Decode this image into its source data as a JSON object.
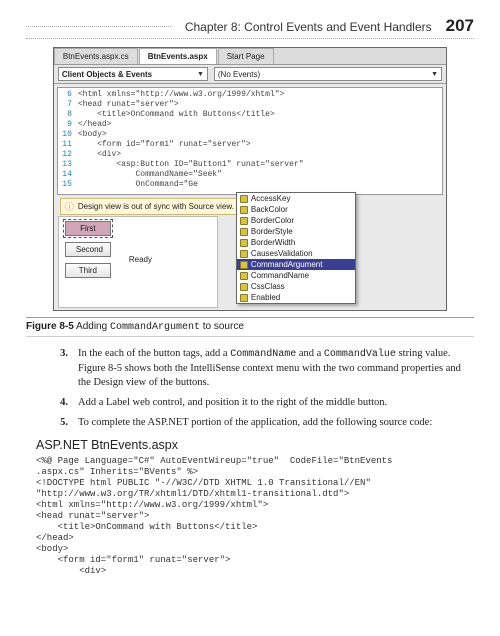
{
  "header": {
    "chapter": "Chapter 8:   Control Events and Event Handlers",
    "page": "207"
  },
  "screenshot": {
    "tabs": {
      "t1": "BtnEvents.aspx.cs",
      "t2": "BtnEvents.aspx",
      "t3": "Start Page"
    },
    "combo_left": "Client Objects & Events",
    "combo_right": "(No Events)",
    "code": {
      "l6": "<html xmlns=\"http://www.w3.org/1999/xhtml\">",
      "l7": "<head runat=\"server\">",
      "l8": "    <title>OnCommand with Buttons</title>",
      "l9": "</head>",
      "l10": "<body>",
      "l11": "    <form id=\"form1\" runat=\"server\">",
      "l12": "    <div>",
      "l13": "        <asp:Button ID=\"Button1\" runat=\"server\"",
      "l14": "            CommandName=\"Seek\"",
      "l15": "            OnCommand=\"Ge"
    },
    "sync_msg": "Design view is out of sync with Source view.",
    "buttons": {
      "b1": "First",
      "b2": "Second",
      "b3": "Third"
    },
    "ready": "Ready",
    "intellisense": {
      "i0": "AccessKey",
      "i1": "BackColor",
      "i2": "BorderColor",
      "i3": "BorderStyle",
      "i4": "BorderWidth",
      "i5": "CausesValidation",
      "i6": "CommandArgument",
      "i7": "CommandName",
      "i8": "CssClass",
      "i9": "Enabled"
    }
  },
  "caption": {
    "label": "Figure 8-5",
    "t1": "Adding ",
    "mono": "CommandArgument",
    "t2": " to source"
  },
  "steps": {
    "s3a": "In the each of the button tags, add a ",
    "s3b": "CommandName",
    "s3c": " and a ",
    "s3d": "CommandValue",
    "s3e": " string value. Figure 8-5 shows both the IntelliSense context menu with the two command properties and the Design view of the buttons.",
    "s4": "Add a Label web control, and position it to the right of the middle button.",
    "s5": "To complete the ASP.NET portion of the application, add the following source code:"
  },
  "subhead": "ASP.NET BtnEvents.aspx",
  "code_listing": "<%@ Page Language=\"C#\" AutoEventWireup=\"true\"  CodeFile=\"BtnEvents\n.aspx.cs\" Inherits=\"BVents\" %>\n<!DOCTYPE html PUBLIC \"-//W3C//DTD XHTML 1.0 Transitional//EN\"\n\"http://www.w3.org/TR/xhtml1/DTD/xhtml1-transitional.dtd\">\n<html xmlns=\"http://www.w3.org/1999/xhtml\">\n<head runat=\"server\">\n    <title>OnCommand with Buttons</title>\n</head>\n<body>\n    <form id=\"form1\" runat=\"server\">\n        <div>"
}
